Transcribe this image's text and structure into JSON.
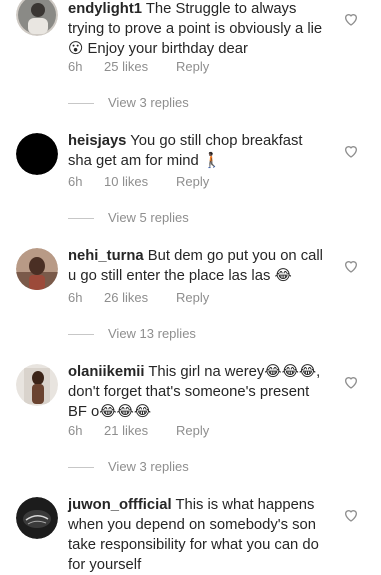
{
  "comments": [
    {
      "username": "endylight1",
      "text": "The Struggle to always trying to prove a point is obviously a lie 😮 Enjoy your birthday dear",
      "time": "6h",
      "likes": "25 likes",
      "reply": "Reply",
      "view_replies": "View 3 replies"
    },
    {
      "username": "heisjays",
      "text": "You go still chop breakfast sha get am for mind 🚶🏿",
      "time": "6h",
      "likes": "10 likes",
      "reply": "Reply",
      "view_replies": "View 5 replies"
    },
    {
      "username": "nehi_turna",
      "text": "But dem go  put you on call u go still enter the place las las 😂",
      "time": "6h",
      "likes": "26 likes",
      "reply": "Reply",
      "view_replies": "View 13 replies"
    },
    {
      "username": "olaniikemii",
      "text": "This girl na werey😂😂😂, don't forget that's someone's present BF o😂😂😂",
      "time": "6h",
      "likes": "21 likes",
      "reply": "Reply",
      "view_replies": "View 3 replies"
    },
    {
      "username": "juwon_offficial",
      "text": "This is what happens when you depend on somebody's son take responsibility for what you can do for yourself"
    }
  ]
}
